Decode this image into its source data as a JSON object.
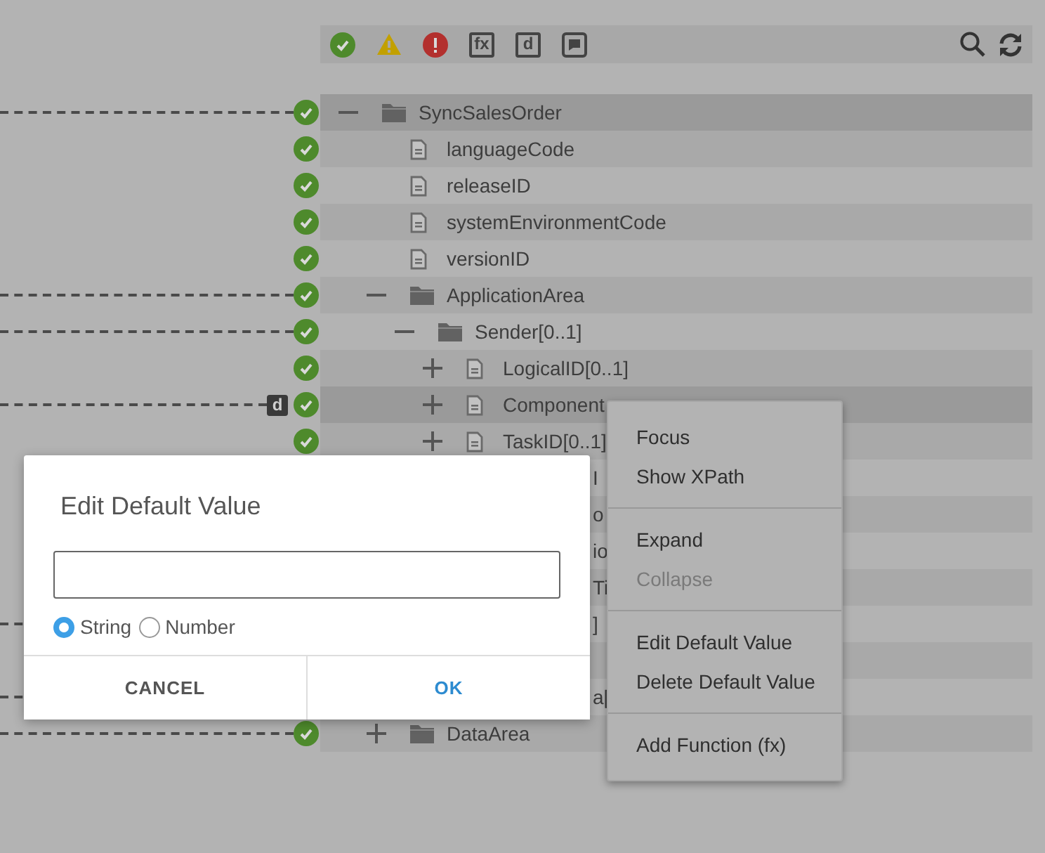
{
  "toolbar": {
    "filters": [
      {
        "kind": "valid"
      },
      {
        "kind": "warning"
      },
      {
        "kind": "error"
      },
      {
        "kind": "boxed",
        "label": "fx"
      },
      {
        "kind": "boxed",
        "label": "d"
      },
      {
        "kind": "comment"
      }
    ],
    "actions": [
      {
        "kind": "search"
      },
      {
        "kind": "refresh"
      }
    ]
  },
  "tree": [
    {
      "label": "SyncSalesOrder",
      "kind": "folder",
      "expanded": true,
      "highlighted": true,
      "check": true,
      "mapped": true,
      "children": [
        {
          "label": "languageCode",
          "kind": "file",
          "highlighted": false,
          "check": true
        },
        {
          "label": "releaseID",
          "kind": "file",
          "highlighted": false,
          "check": true
        },
        {
          "label": "systemEnvironmentCode",
          "kind": "file",
          "highlighted": false,
          "check": true
        },
        {
          "label": "versionID",
          "kind": "file",
          "highlighted": false,
          "check": true
        },
        {
          "label": "ApplicationArea",
          "kind": "folder",
          "expanded": true,
          "highlighted": false,
          "check": true,
          "mapped": true,
          "children": [
            {
              "label": "Sender[0..1]",
              "kind": "folder",
              "expanded": true,
              "highlighted": false,
              "check": true,
              "mapped": true,
              "children": [
                {
                  "label": "LogicalID[0..1]",
                  "kind": "file",
                  "expanded": false,
                  "highlighted": false,
                  "check": true
                },
                {
                  "label": "Component",
                  "kind": "file",
                  "expanded": false,
                  "highlighted": true,
                  "check": true,
                  "mapped": true,
                  "badge": "d"
                },
                {
                  "label": "TaskID[0..1]",
                  "kind": "file",
                  "expanded": false,
                  "highlighted": false,
                  "check": true
                },
                {
                  "label": "I",
                  "kind": "partial",
                  "highlighted": false
                },
                {
                  "label": "o",
                  "kind": "partial",
                  "highlighted": false
                },
                {
                  "label": "io",
                  "kind": "partial",
                  "highlighted": false
                },
                {
                  "label": "Ti",
                  "kind": "partial",
                  "highlighted": false
                },
                {
                  "label": "]",
                  "kind": "partial",
                  "highlighted": false,
                  "mapped": true
                },
                {
                  "kind": "partial"
                },
                {
                  "label": "a[",
                  "kind": "partial",
                  "highlighted": false,
                  "mapped": true
                }
              ]
            }
          ]
        },
        {
          "label": "DataArea",
          "kind": "folder",
          "expanded": false,
          "highlighted": false,
          "check": true,
          "mapped": true
        }
      ]
    }
  ],
  "context_menu": [
    [
      {
        "label": "Focus",
        "disabled": false
      },
      {
        "label": "Show XPath",
        "disabled": false
      }
    ],
    [
      {
        "label": "Expand",
        "disabled": false
      },
      {
        "label": "Collapse",
        "disabled": true
      }
    ],
    [
      {
        "label": "Edit Default Value",
        "disabled": false
      },
      {
        "label": "Delete Default Value",
        "disabled": false
      }
    ],
    [
      {
        "label": "Add Function (fx)",
        "disabled": false
      }
    ]
  ],
  "dialog": {
    "title": "Edit Default Value",
    "types": [
      {
        "label": "String",
        "selected": true
      },
      {
        "label": "Number",
        "selected": false
      }
    ],
    "buttons": [
      {
        "label": "CANCEL",
        "kind": "cancel"
      },
      {
        "label": "OK",
        "kind": "ok"
      }
    ]
  }
}
